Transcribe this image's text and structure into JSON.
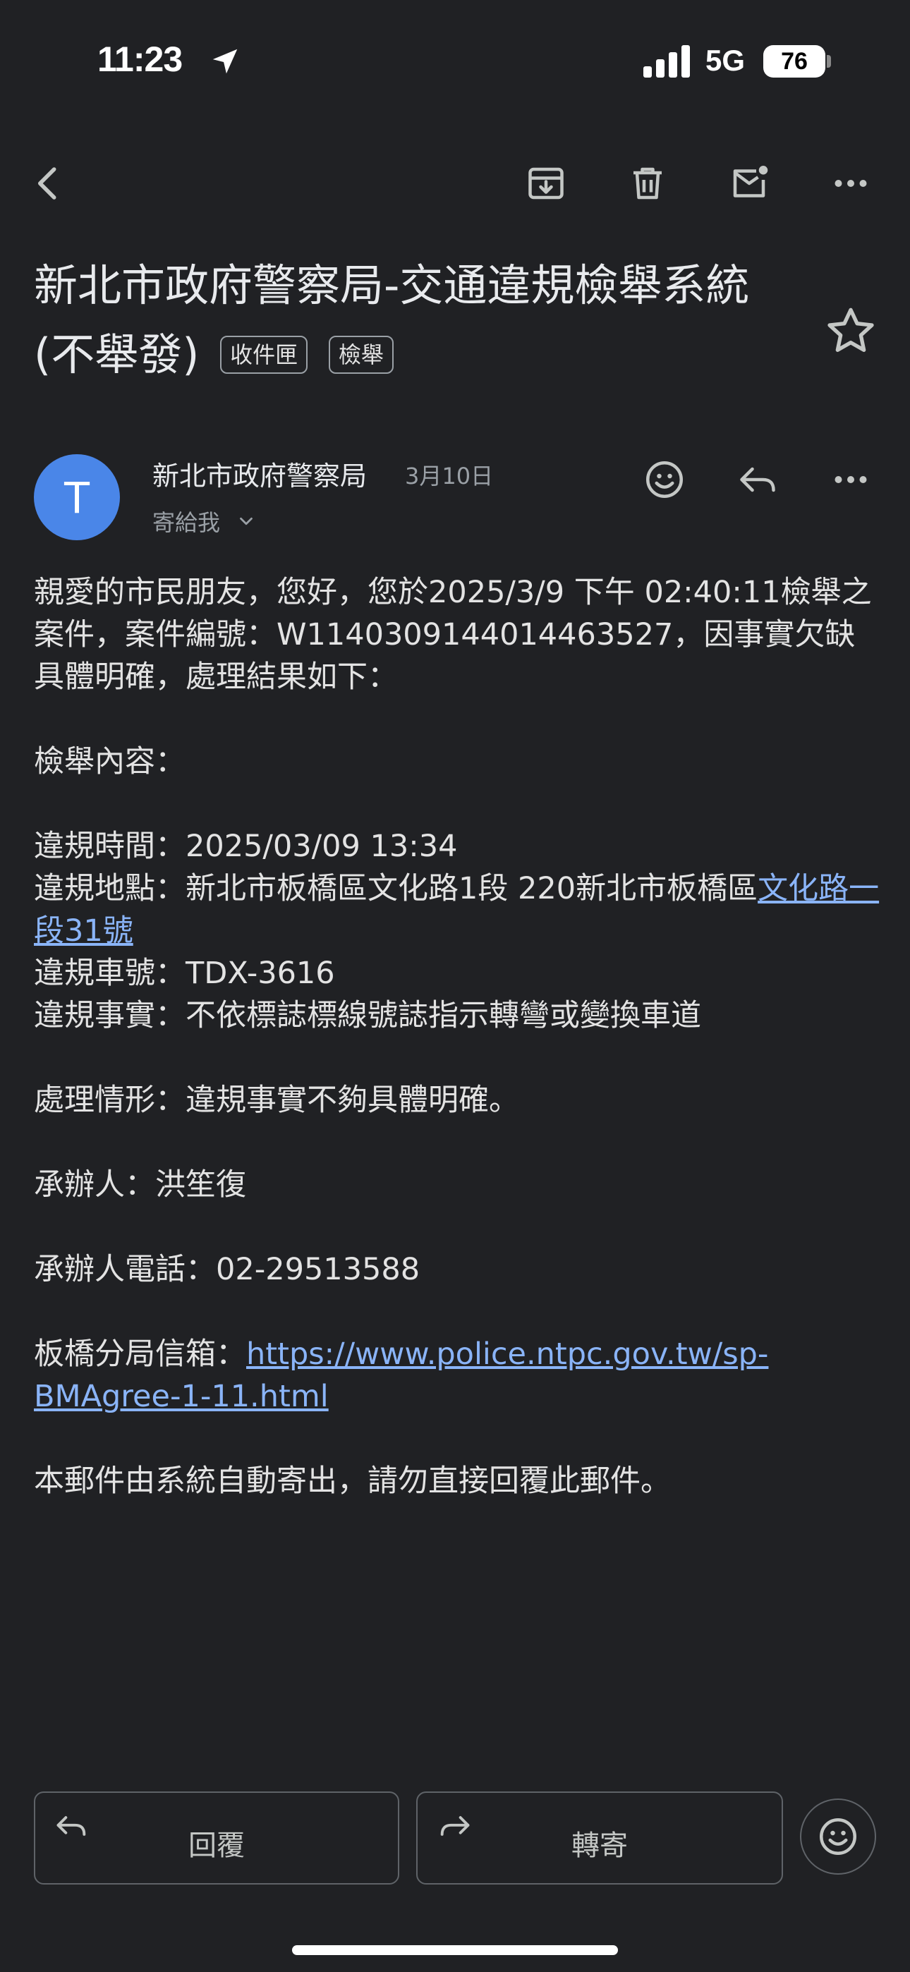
{
  "status_bar": {
    "time": "11:23",
    "network": "5G",
    "battery": "76"
  },
  "toolbar": {
    "icons": [
      "back-arrow-icon",
      "archive-icon",
      "trash-icon",
      "mark-unread-icon",
      "more-icon"
    ]
  },
  "email": {
    "subject": "新北市政府警察局-交通違規檢舉系統(不舉發)",
    "labels": [
      "收件匣",
      "檢舉"
    ],
    "sender_name": "新北市政府警察局",
    "avatar_letter": "T",
    "date": "3月10日",
    "recipient": "寄給我",
    "body": {
      "greeting": "親愛的市民朋友，您好，您於2025/3/9 下午 02:40:11檢舉之案件，案件編號：W1140309144014463527，因事實欠缺具體明確，處理結果如下：",
      "section_title": "檢舉內容：",
      "violation_time": "違規時間：2025/03/09 13:34",
      "violation_place_prefix": "違規地點：新北市板橋區文化路1段 220新北市板橋區",
      "violation_place_link": "文化路一段31號",
      "plate": "違規車號：TDX-3616",
      "fact": "違規事實：不依標誌標線號誌指示轉彎或變換車道",
      "handling": "處理情形：違規事實不夠具體明確。",
      "officer": "承辦人：洪笙復",
      "phone": "承辦人電話：02-29513588",
      "mailbox_prefix": "板橋分局信箱：",
      "mailbox_link": "https://www.police.ntpc.gov.tw/sp-BMAgree-1-11.html",
      "footer": "本郵件由系統自動寄出，請勿直接回覆此郵件。"
    }
  },
  "actions": {
    "reply": "回覆",
    "forward": "轉寄"
  },
  "colors": {
    "background": "#202124",
    "avatar": "#4a86e8",
    "link": "#8ab4f8"
  }
}
